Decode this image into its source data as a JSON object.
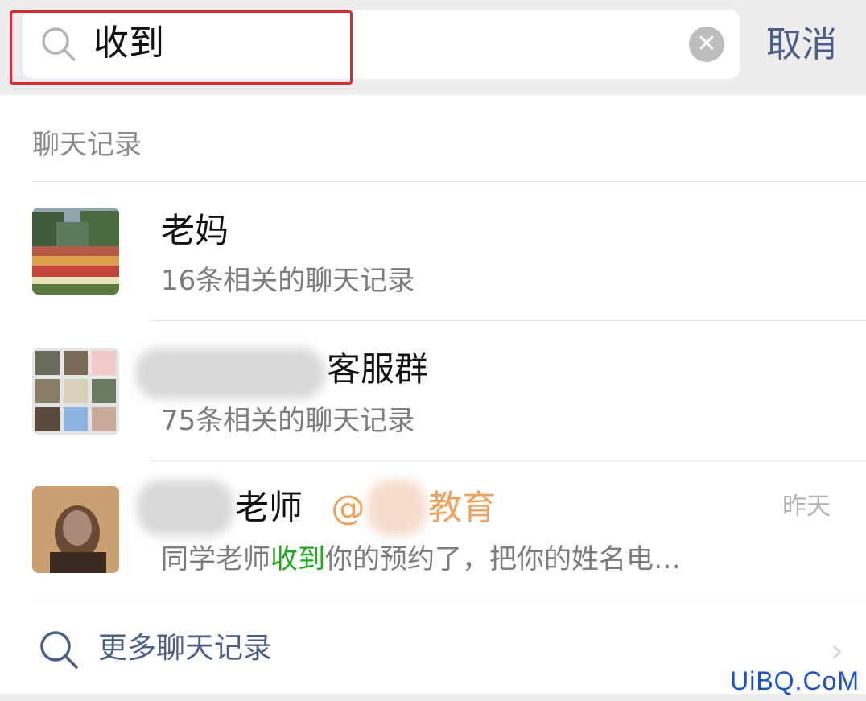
{
  "search": {
    "query": "收到",
    "cancel_label": "取消"
  },
  "section": {
    "title": "聊天记录"
  },
  "results": [
    {
      "name": "老妈",
      "summary": "16条相关的聊天记录"
    },
    {
      "name": "客服群",
      "summary": "75条相关的聊天记录"
    },
    {
      "name": "老师",
      "org": "@",
      "org_suffix": "教育",
      "time": "昨天",
      "preview_before": "同学老师",
      "preview_highlight": "收到",
      "preview_after": "你的预约了，把你的姓名电…"
    }
  ],
  "more": {
    "label": "更多聊天记录"
  },
  "watermark": "UiBQ.CoM",
  "colors": {
    "accent_link": "#4a5e87",
    "highlight": "#1aad19",
    "org": "#f0a15a",
    "annotation": "#e8232d"
  }
}
